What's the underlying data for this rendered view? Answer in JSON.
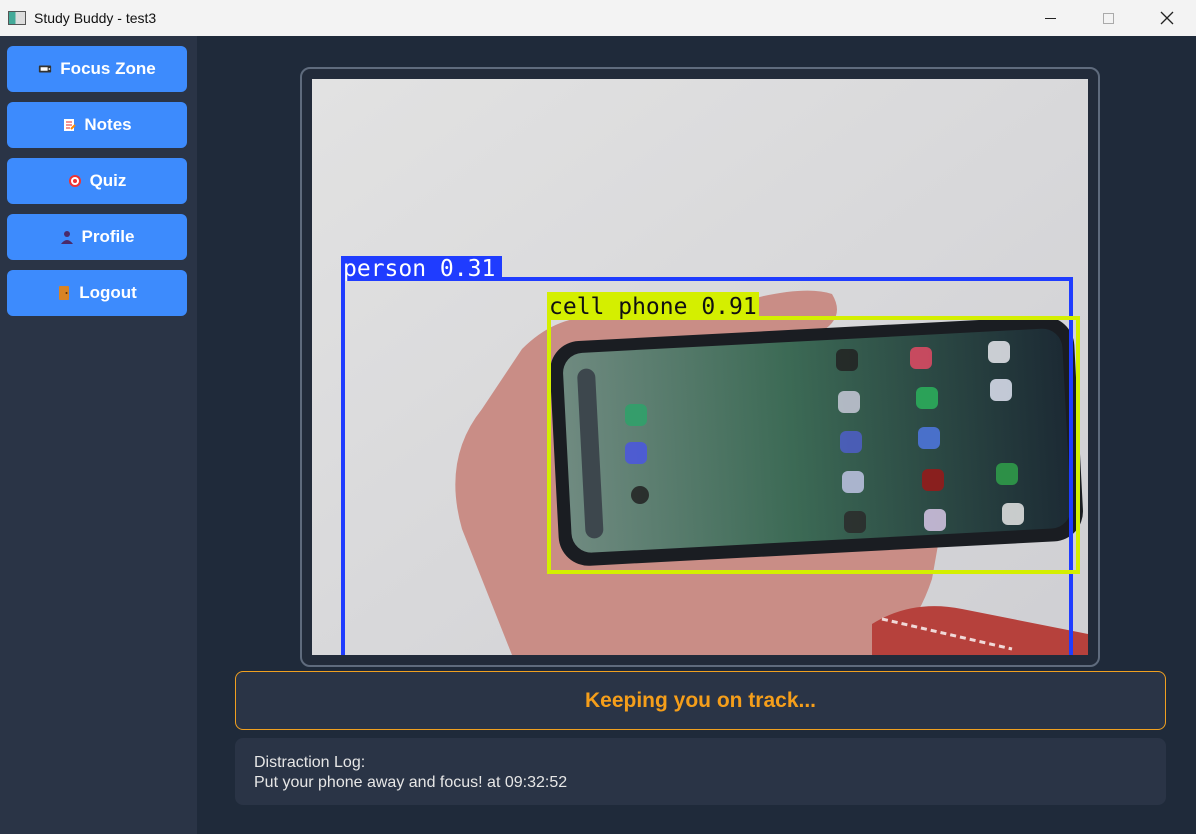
{
  "window": {
    "title": "Study Buddy - test3"
  },
  "sidebar": {
    "items": [
      {
        "label": "Focus Zone",
        "icon": "video-camera-icon"
      },
      {
        "label": "Notes",
        "icon": "memo-icon"
      },
      {
        "label": "Quiz",
        "icon": "target-icon"
      },
      {
        "label": "Profile",
        "icon": "person-icon"
      },
      {
        "label": "Logout",
        "icon": "door-icon"
      }
    ]
  },
  "camera": {
    "detections": [
      {
        "label": "person 0.31",
        "color": "#1f3cff"
      },
      {
        "label": "cell phone 0.91",
        "color": "#d4ef00"
      }
    ]
  },
  "status": {
    "text": "Keeping you on track..."
  },
  "log": {
    "heading": "Distraction Log:",
    "entries": [
      "Put your phone away and focus! at 09:32:52"
    ]
  },
  "colors": {
    "accent": "#3d8bfd",
    "status": "#f59e1a",
    "background": "#1f2a3a",
    "panel": "#2a3446"
  }
}
